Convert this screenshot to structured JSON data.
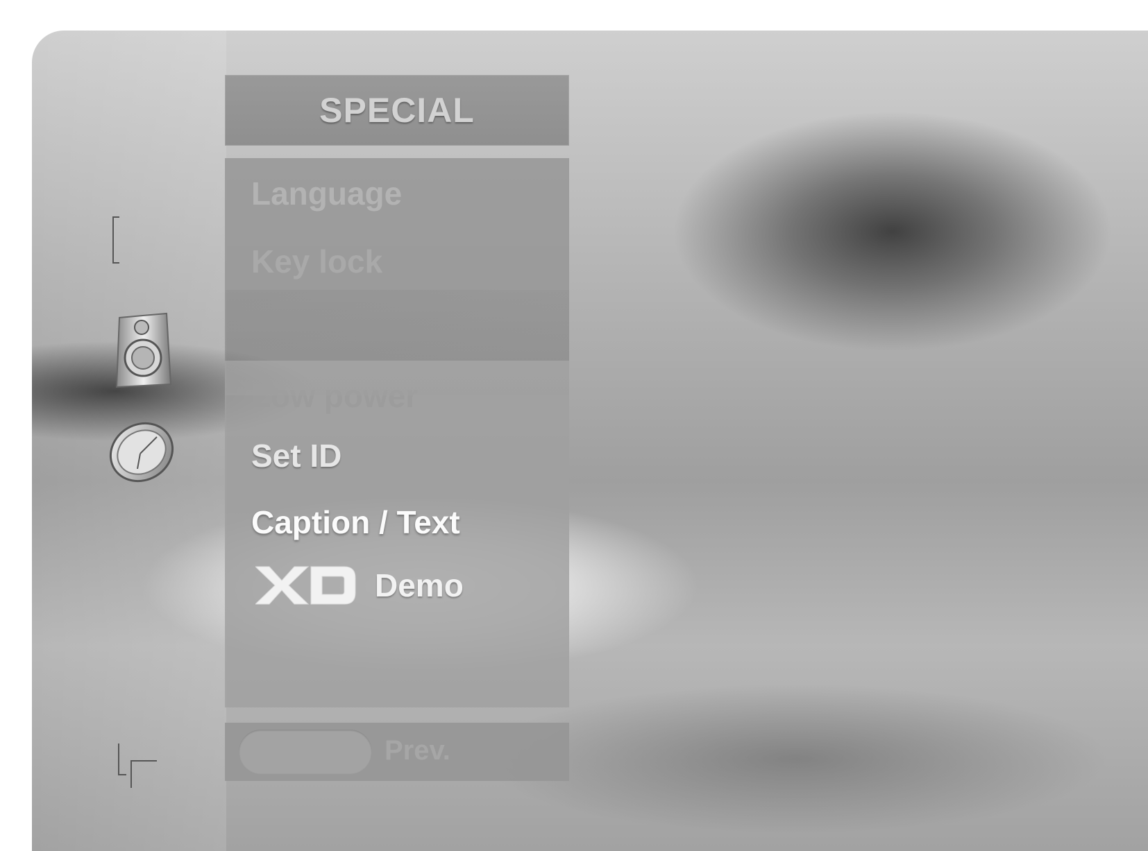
{
  "menu": {
    "title": "SPECIAL",
    "items": [
      {
        "label": "Language",
        "state": "disabled"
      },
      {
        "label": "Key lock",
        "state": "disabled"
      },
      {
        "label": "Low power",
        "state": "disabled"
      },
      {
        "label": "Set ID",
        "state": "enabled"
      },
      {
        "label": "Caption / Text",
        "state": "highlighted"
      },
      {
        "label": "Demo",
        "state": "enabled",
        "prefix_logo": "XD"
      }
    ]
  },
  "footer": {
    "button_label": "Prev."
  },
  "side_icons": [
    "audio-speaker-icon",
    "time-clock-icon"
  ],
  "colors": {
    "panel": "#9c9c9c",
    "highlight_text": "#fbfbfb",
    "dim_text": "#b3b3b3"
  }
}
